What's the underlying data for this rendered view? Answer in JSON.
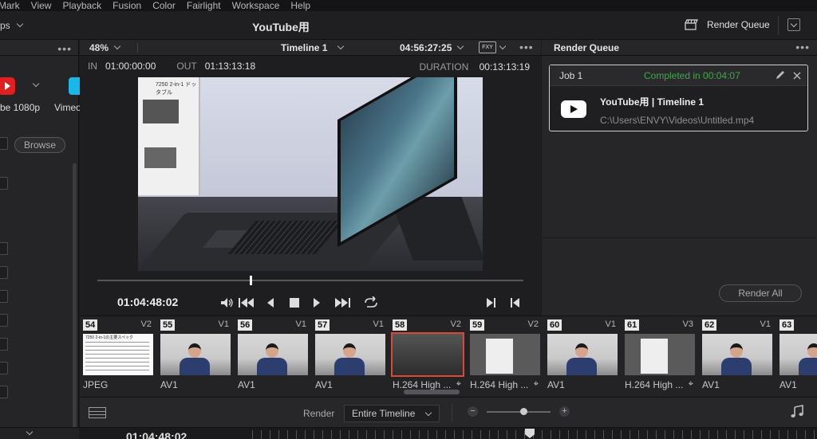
{
  "menubar": [
    "Mark",
    "View",
    "Playback",
    "Fusion",
    "Color",
    "Fairlight",
    "Workspace",
    "Help"
  ],
  "topbar": {
    "workspace_partial": "ps",
    "project_title": "YouTube用",
    "render_queue_label": "Render Queue"
  },
  "left_panel": {
    "preset_youtube_label": "be 1080p",
    "preset_vimeo_label": "Vimeo",
    "browse_label": "Browse"
  },
  "viewer": {
    "zoom": "48%",
    "timeline_name": "Timeline 1",
    "timecode_top": "04:56:27:25",
    "fx_badge": "FXY",
    "in_label": "IN",
    "in_value": "01:00:00:00",
    "out_label": "OUT",
    "out_value": "01:13:13:18",
    "duration_label": "DURATION",
    "duration_value": "00:13:13:19",
    "current_timecode": "01:04:48:02",
    "box_text": "7250 2-in-1 ドッタブル",
    "scrub_progress": 0.36
  },
  "render_queue": {
    "title": "Render Queue",
    "job": {
      "name": "Job 1",
      "status": "Completed in 00:04:07",
      "title": "YouTube用 | Timeline 1",
      "path": "C:\\Users\\ENVY\\Videos\\Untitled.mp4"
    },
    "render_all_label": "Render All",
    "status_color": "#3daa4a"
  },
  "clips": [
    {
      "num": "54",
      "track": "V2",
      "codec": "JPEG",
      "kind": "sheet",
      "target": false,
      "sheet_title": "7250 2-in-1の主要スペック"
    },
    {
      "num": "55",
      "track": "V1",
      "codec": "AV1",
      "kind": "person",
      "target": false
    },
    {
      "num": "56",
      "track": "V1",
      "codec": "AV1",
      "kind": "person",
      "target": false
    },
    {
      "num": "57",
      "track": "V1",
      "codec": "AV1",
      "kind": "person",
      "target": false
    },
    {
      "num": "58",
      "track": "V2",
      "codec": "H.264 High ...",
      "kind": "dark",
      "target": true,
      "selected": true
    },
    {
      "num": "59",
      "track": "V2",
      "codec": "H.264 High ...",
      "kind": "box2",
      "target": true
    },
    {
      "num": "60",
      "track": "V1",
      "codec": "AV1",
      "kind": "person",
      "target": false
    },
    {
      "num": "61",
      "track": "V3",
      "codec": "H.264 High ...",
      "kind": "box2",
      "target": true
    },
    {
      "num": "62",
      "track": "V1",
      "codec": "AV1",
      "kind": "person",
      "target": false
    },
    {
      "num": "63",
      "track": "",
      "codec": "AV1",
      "kind": "person",
      "target": false
    }
  ],
  "bottombar": {
    "render_label": "Render",
    "render_range": "Entire Timeline"
  },
  "ruler": {
    "timecode": "01:04:48:02"
  },
  "icons": {
    "render_queue_icon": "clapper-icon",
    "speaker": "speaker-icon",
    "music": "music-note-icon"
  }
}
